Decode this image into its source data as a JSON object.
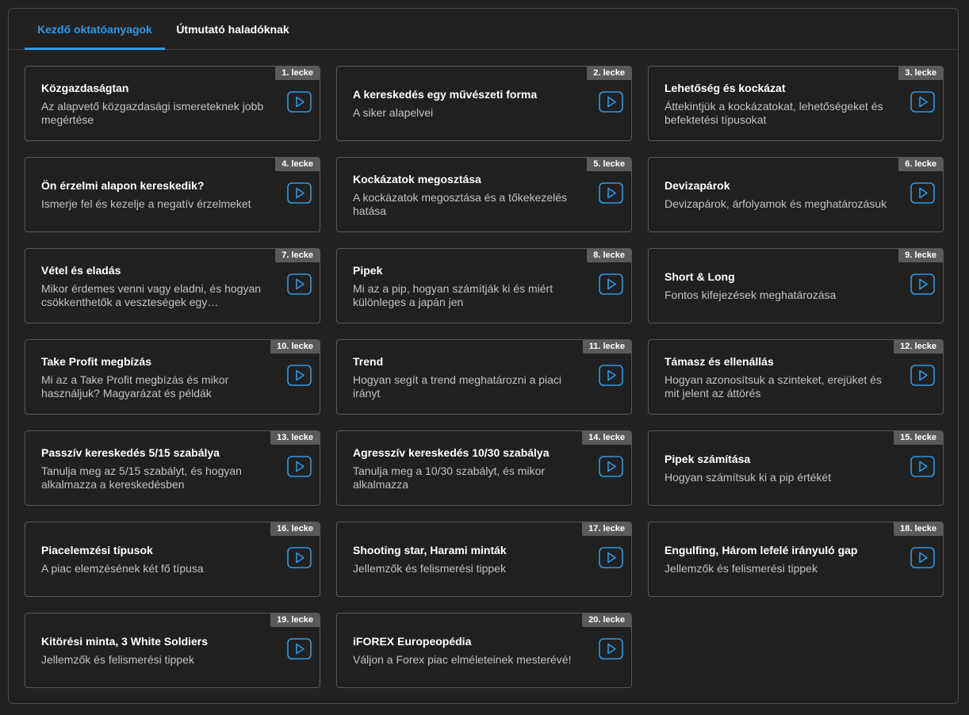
{
  "tabs": [
    {
      "label": "Kezdő oktatóanyagok",
      "active": true
    },
    {
      "label": "Útmutató haladóknak",
      "active": false
    }
  ],
  "accent_color": "#2f98e4",
  "play_icon": "play-icon",
  "lessons": [
    {
      "badge": "1. lecke",
      "title": "Közgazdaságtan",
      "desc": "Az alapvető közgazdasági ismereteknek jobb megértése"
    },
    {
      "badge": "2. lecke",
      "title": "A kereskedés egy művészeti forma",
      "desc": "A siker alapelvei"
    },
    {
      "badge": "3. lecke",
      "title": "Lehetőség és kockázat",
      "desc": "Áttekintjük a kockázatokat, lehetőségeket és befektetési típusokat"
    },
    {
      "badge": "4. lecke",
      "title": "Ön érzelmi alapon kereskedik?",
      "desc": "Ismerje fel és kezelje a negatív érzelmeket"
    },
    {
      "badge": "5. lecke",
      "title": "Kockázatok megosztása",
      "desc": "A kockázatok megosztása és a tőkekezelés hatása"
    },
    {
      "badge": "6. lecke",
      "title": "Devizapárok",
      "desc": "Devizapárok, árfolyamok és meghatározásuk"
    },
    {
      "badge": "7. lecke",
      "title": "Vétel és eladás",
      "desc": "Mikor érdemes venni vagy eladni, és hogyan csökkenthetők a veszteségek egy…"
    },
    {
      "badge": "8. lecke",
      "title": "Pipek",
      "desc": "Mi az a pip, hogyan számítják ki és miért különleges a japán jen"
    },
    {
      "badge": "9. lecke",
      "title": "Short & Long",
      "desc": "Fontos kifejezések meghatározása"
    },
    {
      "badge": "10. lecke",
      "title": "Take Profit megbízás",
      "desc": "Mi az a Take Profit megbízás és mikor használjuk? Magyarázat és példák"
    },
    {
      "badge": "11. lecke",
      "title": "Trend",
      "desc": "Hogyan segít a trend meghatározni a piaci irányt"
    },
    {
      "badge": "12. lecke",
      "title": "Támasz és ellenállás",
      "desc": "Hogyan azonosítsuk a szinteket, erejüket és mit jelent az áttörés"
    },
    {
      "badge": "13. lecke",
      "title": "Passzív kereskedés 5/15 szabálya",
      "desc": "Tanulja meg az 5/15 szabályt, és hogyan alkalmazza a kereskedésben"
    },
    {
      "badge": "14. lecke",
      "title": "Agresszív kereskedés 10/30 szabálya",
      "desc": "Tanulja meg a 10/30 szabályt, és mikor alkalmazza"
    },
    {
      "badge": "15. lecke",
      "title": "Pipek számítása",
      "desc": "Hogyan számítsuk ki a pip értékét"
    },
    {
      "badge": "16. lecke",
      "title": "Piacelemzési típusok",
      "desc": "A piac elemzésének két fő típusa"
    },
    {
      "badge": "17. lecke",
      "title": "Shooting star, Harami minták",
      "desc": "Jellemzők és felismerési tippek"
    },
    {
      "badge": "18. lecke",
      "title": "Engulfing, Három lefelé irányuló gap",
      "desc": "Jellemzők és felismerési tippek"
    },
    {
      "badge": "19. lecke",
      "title": "Kitörési minta, 3 White Soldiers",
      "desc": "Jellemzők és felismerési tippek"
    },
    {
      "badge": "20. lecke",
      "title": "iFOREX Europeopédia",
      "desc": "Váljon a Forex piac elméleteinek mesterévé!"
    }
  ]
}
